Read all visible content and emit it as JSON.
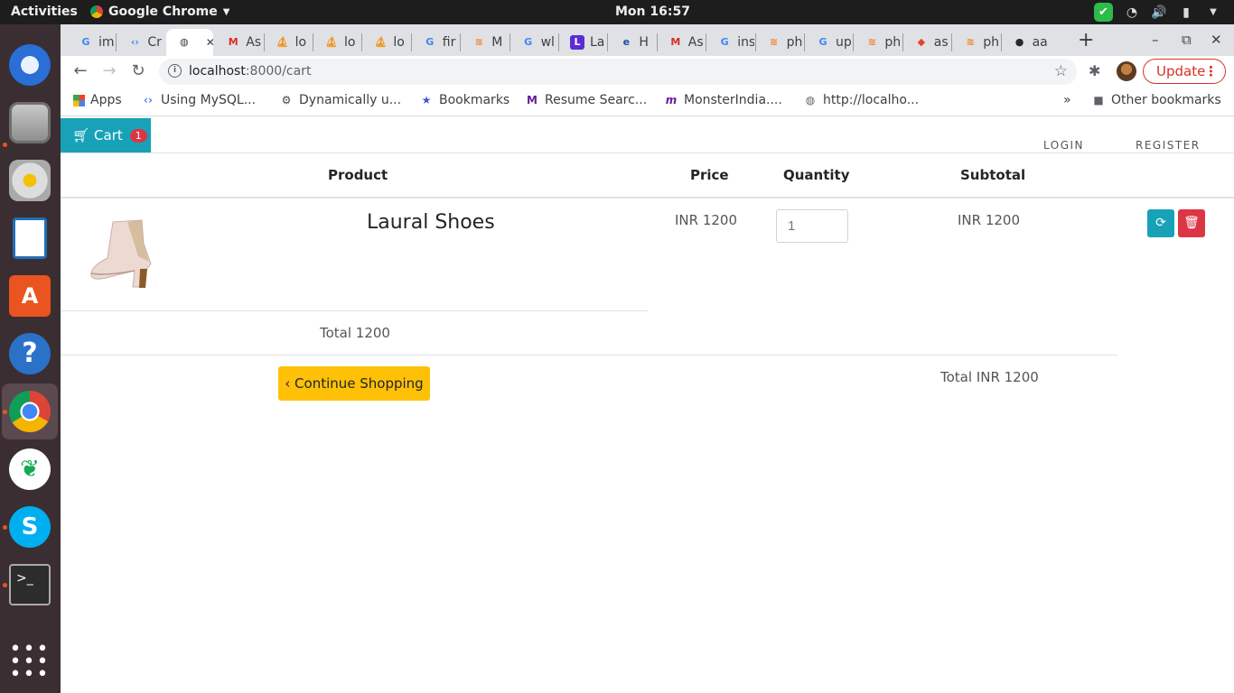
{
  "system": {
    "activities": "Activities",
    "app_name": "Google Chrome",
    "clock": "Mon 16:57"
  },
  "tabs": [
    {
      "title": "im",
      "icon": "google"
    },
    {
      "title": "Cr",
      "icon": "code"
    },
    {
      "title": "",
      "icon": "globe",
      "active": true
    },
    {
      "title": "As",
      "icon": "gmail"
    },
    {
      "title": "lo",
      "icon": "phpmyadmin"
    },
    {
      "title": "lo",
      "icon": "phpmyadmin"
    },
    {
      "title": "lo",
      "icon": "phpmyadmin"
    },
    {
      "title": "fir",
      "icon": "google"
    },
    {
      "title": "M",
      "icon": "stackoverflow"
    },
    {
      "title": "wl",
      "icon": "google"
    },
    {
      "title": "La",
      "icon": "laravel"
    },
    {
      "title": "H",
      "icon": "experts-exchange"
    },
    {
      "title": "As",
      "icon": "gmail"
    },
    {
      "title": "ins",
      "icon": "google"
    },
    {
      "title": "ph",
      "icon": "stackoverflow"
    },
    {
      "title": "up",
      "icon": "google"
    },
    {
      "title": "ph",
      "icon": "stackoverflow"
    },
    {
      "title": "as",
      "icon": "gitlab"
    },
    {
      "title": "ph",
      "icon": "stackoverflow"
    },
    {
      "title": "aa",
      "icon": "github"
    }
  ],
  "toolbar": {
    "url_host": "localhost",
    "url_rest": ":8000/cart",
    "update_label": "Update"
  },
  "bookmarks": {
    "items": [
      "Apps",
      "Using MySQL...",
      "Dynamically u...",
      "Bookmarks",
      "Resume Searc...",
      "MonsterIndia....",
      "http://localho..."
    ],
    "other": "Other bookmarks",
    "overflow": "»"
  },
  "page": {
    "cart_label": "Cart",
    "cart_count": "1",
    "login": "LOGIN",
    "register": "REGISTER",
    "headers": {
      "product": "Product",
      "price": "Price",
      "quantity": "Quantity",
      "subtotal": "Subtotal"
    },
    "item": {
      "name": "Laural Shoes",
      "price": "INR 1200",
      "quantity": "1",
      "subtotal": "INR 1200"
    },
    "total_left": "Total 1200",
    "continue_label": "Continue Shopping",
    "total_right": "Total INR 1200"
  },
  "colors": {
    "cart_button": "#17a2b8",
    "badge": "#dc3545",
    "delete_button": "#dc3545",
    "continue_button": "#ffc107",
    "update_button": "#d93025"
  }
}
